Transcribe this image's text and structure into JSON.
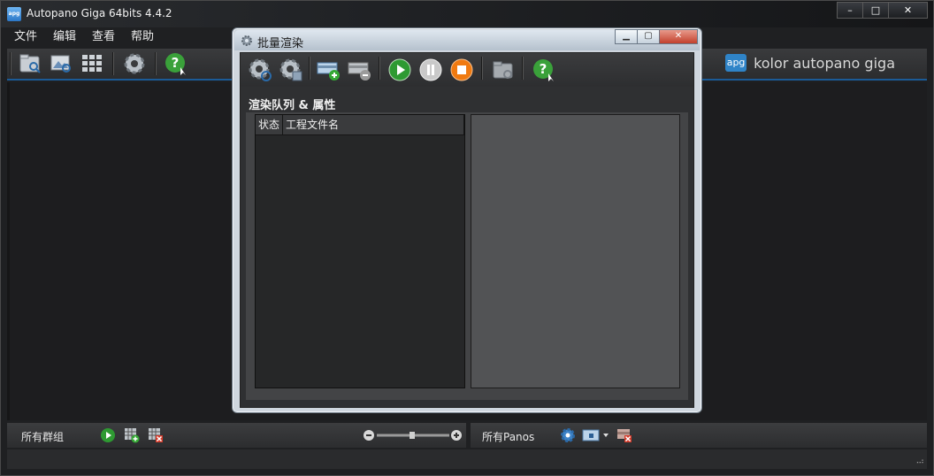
{
  "window": {
    "title": "Autopano Giga 64bits 4.4.2",
    "app_icon_text": "apg",
    "controls": {
      "minimize": "–",
      "maximize": "□",
      "close": "✕"
    }
  },
  "menu": [
    "文件",
    "编辑",
    "查看",
    "帮助"
  ],
  "toolbar": {
    "icons": [
      "open-folder-icon",
      "detect-images-icon",
      "select-all-icon",
      "settings-gear-icon",
      "help-icon"
    ],
    "accent_color": "#1b5b97"
  },
  "brand": {
    "logo_text": "apg",
    "name": "kolor autopano giga",
    "logo_color": "#2f84c8"
  },
  "bottom_left": {
    "label": "所有群组"
  },
  "bottom_right": {
    "label": "所有Panos"
  },
  "batch_dialog": {
    "title": "批量渲染",
    "controls": {
      "minimize": "▁",
      "maximize": "▢",
      "close": "✕"
    },
    "toolbar_icons": [
      "add-group-icon",
      "save-settings-icon",
      "add-pano-icon",
      "remove-pano-icon",
      "play-icon",
      "pause-icon",
      "stop-icon",
      "open-folder-icon",
      "help-icon"
    ],
    "section_title": "渲染队列 & 属性",
    "columns": {
      "status": "状态",
      "project_file": "工程文件名"
    },
    "rows": []
  }
}
